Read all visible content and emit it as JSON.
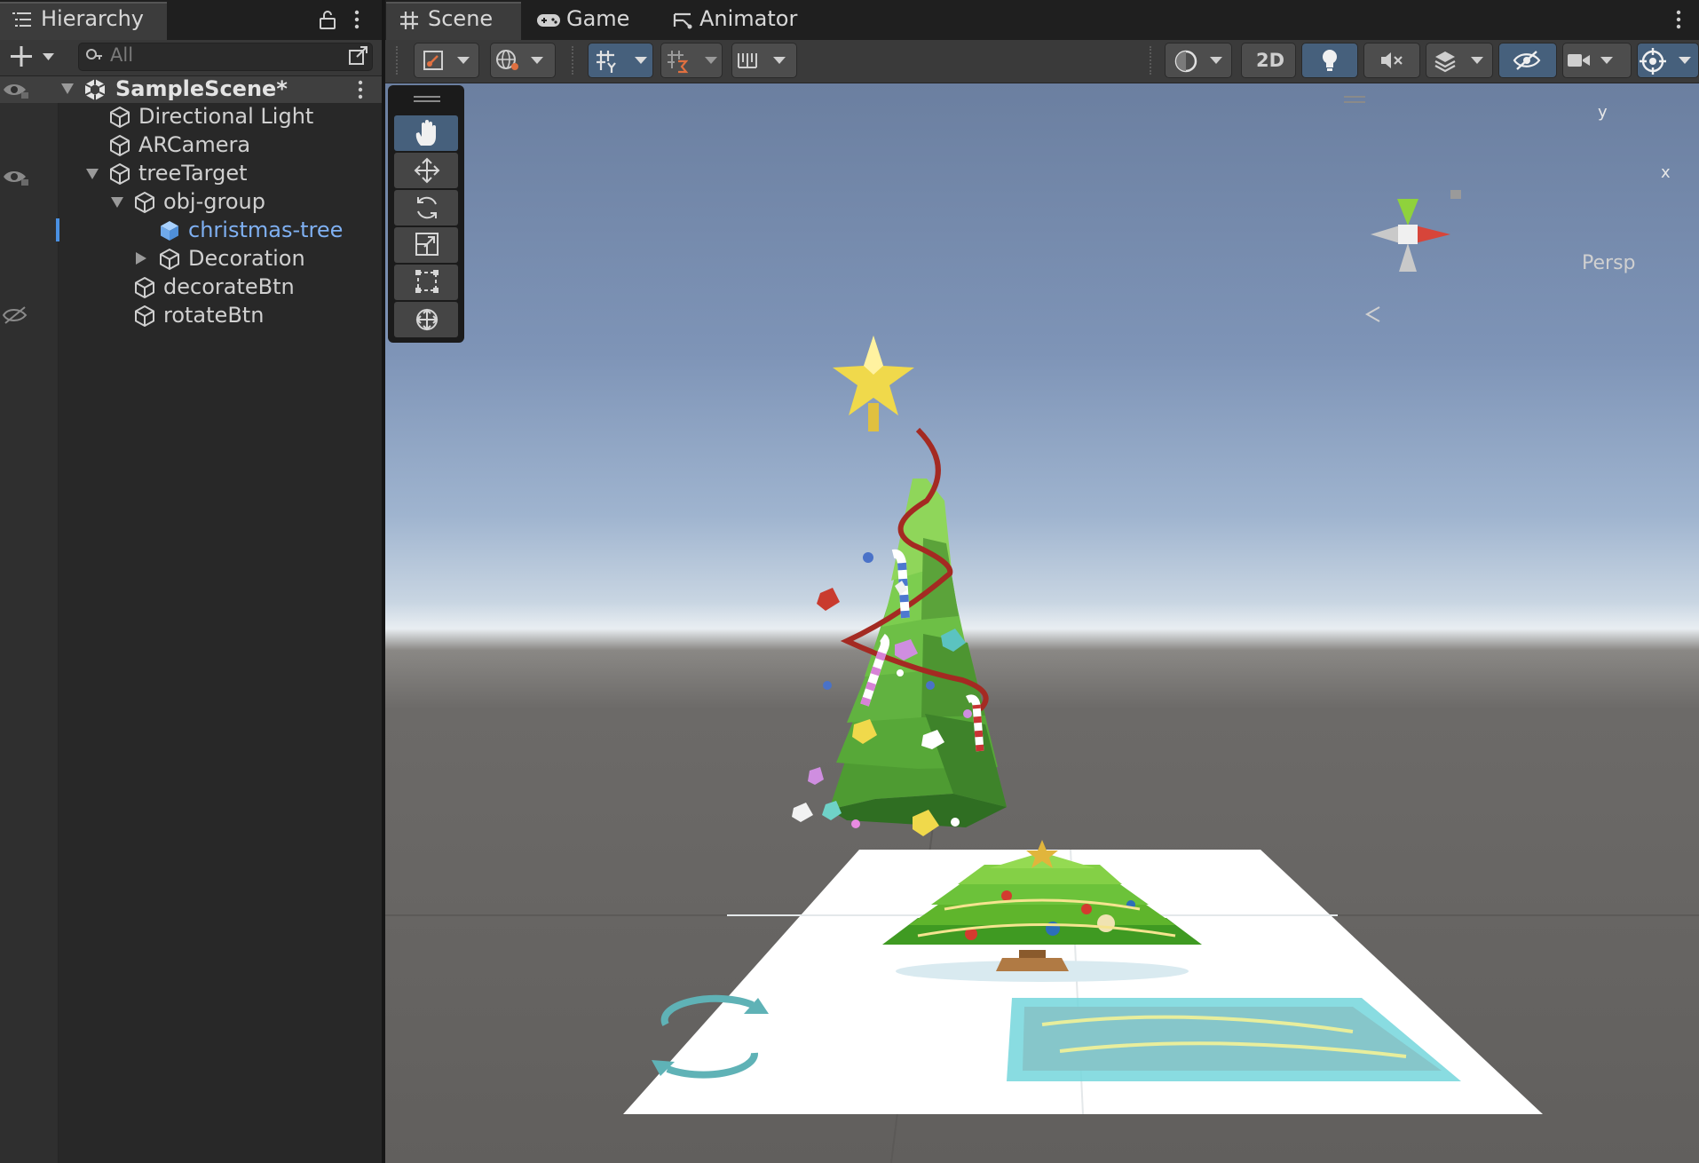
{
  "hierarchy": {
    "tab_label": "Hierarchy",
    "search_placeholder": "All",
    "scene_name": "SampleScene*",
    "items": [
      {
        "label": "Directional Light"
      },
      {
        "label": "ARCamera"
      },
      {
        "label": "treeTarget"
      },
      {
        "label": "obj-group"
      },
      {
        "label": "christmas-tree",
        "selected": true
      },
      {
        "label": "Decoration"
      },
      {
        "label": "decorateBtn"
      },
      {
        "label": "rotateBtn"
      }
    ]
  },
  "scene_tabs": [
    {
      "label": "Scene",
      "icon": "grid-hash-icon",
      "active": true
    },
    {
      "label": "Game",
      "icon": "gamepad-icon"
    },
    {
      "label": "Animator",
      "icon": "animator-icon"
    }
  ],
  "scene_toolbar": {
    "mode_2d_label": "2D"
  },
  "gizmo": {
    "projection_label": "Persp",
    "axis_y": "y",
    "axis_x": "x"
  },
  "colors": {
    "selection_accent": "#7fb0f2",
    "toggle_on": "#46607c",
    "axis_x": "#d7453a",
    "axis_y": "#8fd23c"
  }
}
